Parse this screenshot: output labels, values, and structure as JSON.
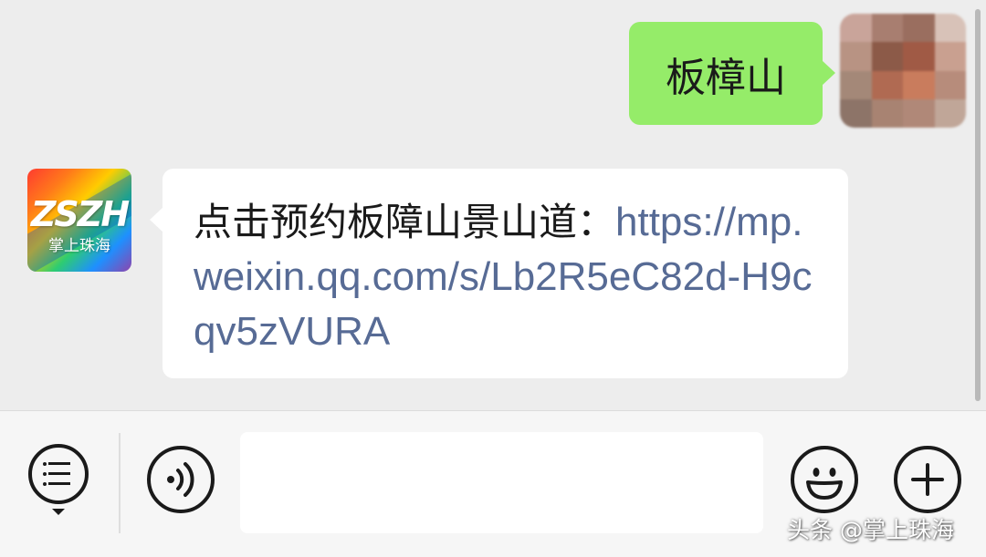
{
  "chat": {
    "outgoing_message": {
      "text": "板樟山",
      "bubble_color": "#95ec69",
      "avatar": "pixelated-user-avatar"
    },
    "incoming_message": {
      "prefix_text": "点击预约板障山景山道：",
      "link_text": "https://mp.weixin.qq.com/s/Lb2R5eC82d-H9cqv5zVURA",
      "link_color": "#576b95",
      "avatar": {
        "logo_main": "ZSZH",
        "logo_sub": "掌上珠海"
      }
    }
  },
  "input_bar": {
    "menu_icon": "menu-list-icon",
    "voice_icon": "voice-icon",
    "emoji_icon": "emoji-icon",
    "plus_icon": "plus-icon",
    "input_value": ""
  },
  "watermark": {
    "text": "头条 @掌上珠海"
  },
  "colors": {
    "chat_background": "#ededed",
    "input_bar_background": "#f6f6f6"
  }
}
